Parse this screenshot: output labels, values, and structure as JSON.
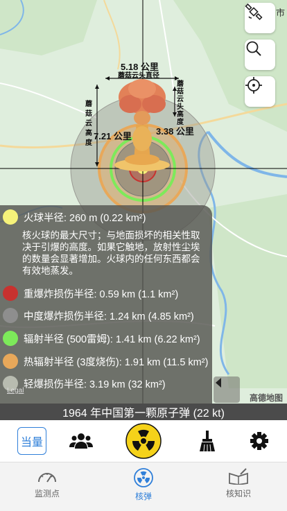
{
  "map": {
    "city_label": "市",
    "cloud_width_label": "5.18 公里",
    "cloud_width_caption": "蘑菇云头直径",
    "cloud_head_height_caption": "蘑菇云头高度",
    "cloud_head_height_label": "3.38 公里",
    "cloud_height_caption": "蘑菇云高度",
    "cloud_height_label": "7.21 公里",
    "legal": "Legal",
    "provider": "高德地图"
  },
  "legend": {
    "fireball": {
      "label": "火球半径: 260 m (0.22 km²)",
      "color": "#f6f27a"
    },
    "fireball_desc": "核火球的最大尺寸；与地面损坏的相关性取决于引爆的高度。如果它触地，放射性尘埃的数量会显著增加。火球内的任何东西都会有效地蒸发。",
    "heavy": {
      "label": "重爆炸损伤半径: 0.59 km (1.1 km²)",
      "color": "#c8322f"
    },
    "medium": {
      "label": "中度爆炸损伤半径: 1.24 km (4.85 km²)",
      "color": "#8e8e8e"
    },
    "radiation": {
      "label": "辐射半径 (500雷姆): 1.41 km (6.22 km²)",
      "color": "#7dea5a"
    },
    "thermal": {
      "label": "热辐射半径 (3度烧伤): 1.91 km (11.5 km²)",
      "color": "#e8a85a"
    },
    "light": {
      "label": "轻爆损伤半径: 3.19 km (32 km²)",
      "color": "#b8bcb0"
    }
  },
  "caption": "1964 年中国第一颗原子弹 (22 kt)",
  "toolbar": {
    "yield_label": "当量"
  },
  "tabs": [
    {
      "label": "监测点"
    },
    {
      "label": "核弹"
    },
    {
      "label": "核知识"
    }
  ],
  "colors": {
    "accent": "#2f7fd9",
    "nuke_yellow": "#f5d21a"
  }
}
